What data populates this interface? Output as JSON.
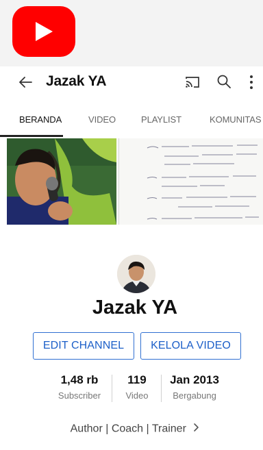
{
  "app": {
    "title": "Jazak YA"
  },
  "tabs": [
    {
      "label": "BERANDA",
      "active": true
    },
    {
      "label": "VIDEO",
      "active": false
    },
    {
      "label": "PLAYLIST",
      "active": false
    },
    {
      "label": "KOMUNITAS",
      "active": false
    }
  ],
  "channel": {
    "name": "Jazak YA",
    "description": "Author | Coach | Trainer"
  },
  "buttons": {
    "edit_channel": "EDIT CHANNEL",
    "kelola_video": "KELOLA VIDEO"
  },
  "stats": [
    {
      "value": "1,48 rb",
      "label": "Subscriber"
    },
    {
      "value": "119",
      "label": "Video"
    },
    {
      "value": "Jan 2013",
      "label": "Bergabung"
    }
  ],
  "icons": {
    "app_logo": "youtube-logo-icon",
    "back": "arrow-left-icon",
    "cast": "cast-icon",
    "search": "search-icon",
    "more": "more-vertical-icon",
    "description_chevron": "chevron-right-icon"
  },
  "colors": {
    "brand_red": "#ff0000",
    "button_blue": "#1c5fc8",
    "background": "#ffffff"
  }
}
